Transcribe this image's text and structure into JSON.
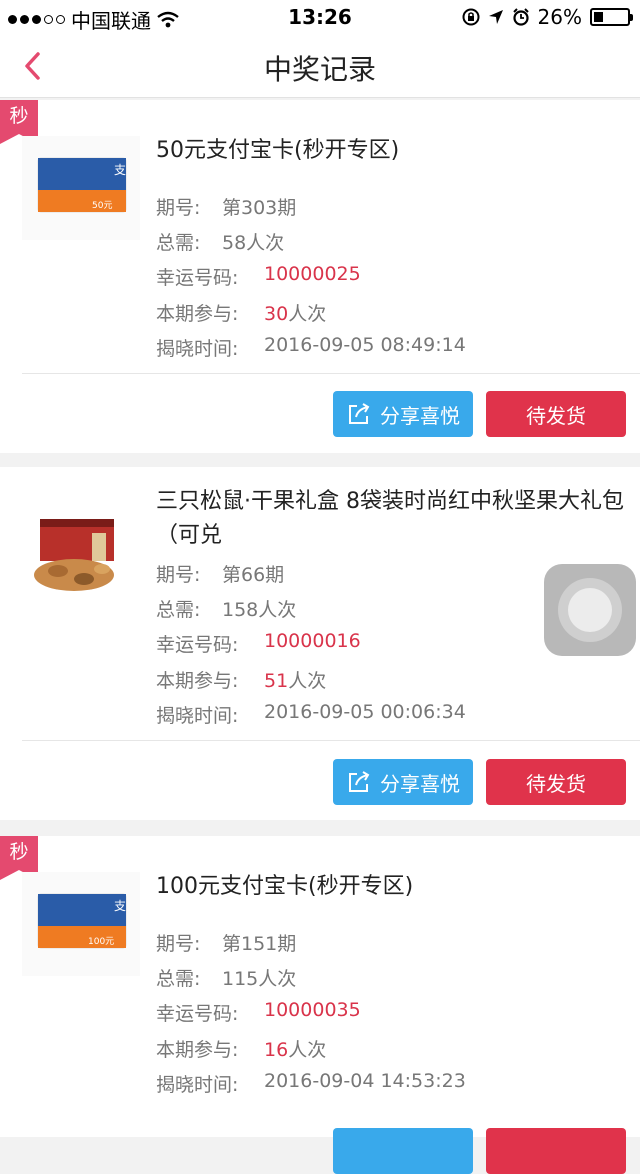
{
  "status_bar": {
    "carrier": "中国联通",
    "time": "13:26",
    "battery": "26%"
  },
  "nav": {
    "title": "中奖记录"
  },
  "labels": {
    "issue": "期号:",
    "total": "总需:",
    "lucky": "幸运号码:",
    "joined": "本期参与:",
    "reveal_time": "揭晓时间:",
    "share": "分享喜悦",
    "ship": "待发货",
    "seckill": "秒"
  },
  "records": [
    {
      "title": "50元支付宝卡(秒开专区)",
      "issue": "第303期",
      "total": "58人次",
      "lucky": "10000025",
      "joined_count": "30",
      "joined_unit": "人次",
      "reveal_time": "2016-09-05 08:49:14",
      "card_value": "50元"
    },
    {
      "title": "三只松鼠·干果礼盒 8袋装时尚红中秋坚果大礼包（可兑",
      "issue": "第66期",
      "total": "158人次",
      "lucky": "10000016",
      "joined_count": "51",
      "joined_unit": "人次",
      "reveal_time": "2016-09-05 00:06:34"
    },
    {
      "title": "100元支付宝卡(秒开专区)",
      "issue": "第151期",
      "total": "115人次",
      "lucky": "10000035",
      "joined_count": "16",
      "joined_unit": "人次",
      "reveal_time": "2016-09-04 14:53:23",
      "card_value": "100元"
    }
  ],
  "colors": {
    "accent": "#e44a6f",
    "share_button": "#39a9eb",
    "ship_button": "#e0334b",
    "highlight_text": "#d9344b"
  }
}
